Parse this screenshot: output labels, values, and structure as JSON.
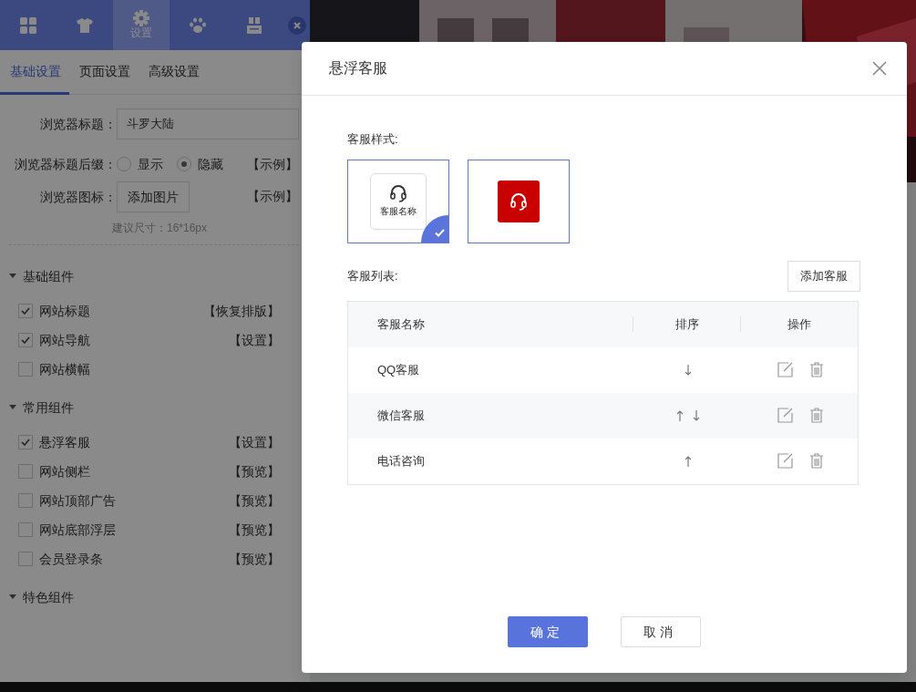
{
  "toolbar": {
    "tabs": [
      {
        "kind": "grid",
        "selected": false
      },
      {
        "kind": "shirt",
        "selected": false
      },
      {
        "kind": "gear",
        "label": "设置",
        "selected": true
      },
      {
        "kind": "paw",
        "selected": false
      },
      {
        "kind": "blocks",
        "selected": false
      }
    ]
  },
  "sub_tabs": [
    {
      "label": "基础设置",
      "selected": true
    },
    {
      "label": "页面设置",
      "selected": false
    },
    {
      "label": "高级设置",
      "selected": false
    }
  ],
  "form": {
    "title_field": {
      "label": "浏览器标题：",
      "value": "斗罗大陆"
    },
    "suffix": {
      "label": "浏览器标题后缀：",
      "options": [
        {
          "label": "显示",
          "selected": false
        },
        {
          "label": "隐藏",
          "selected": true
        }
      ],
      "link": "【示例】"
    },
    "favicon": {
      "label": "浏览器图标：",
      "button": "添加图片",
      "link": "【示例】",
      "hint": "建议尺寸：16*16px"
    }
  },
  "groups": [
    {
      "title": "基础组件",
      "expanded": true,
      "items": [
        {
          "label": "网站标题",
          "checked": true,
          "action": "【恢复排版】"
        },
        {
          "label": "网站导航",
          "checked": true,
          "action": "【设置】"
        },
        {
          "label": "网站横幅",
          "checked": false
        }
      ]
    },
    {
      "title": "常用组件",
      "expanded": true,
      "items": [
        {
          "label": "悬浮客服",
          "checked": true,
          "action": "【设置】"
        },
        {
          "label": "网站侧栏",
          "checked": false,
          "action": "【预览】"
        },
        {
          "label": "网站顶部广告",
          "checked": false,
          "action": "【预览】"
        },
        {
          "label": "网站底部浮层",
          "checked": false,
          "action": "【预览】"
        },
        {
          "label": "会员登录条",
          "checked": false,
          "action": "【预览】"
        }
      ]
    },
    {
      "title": "特色组件",
      "expanded": true
    }
  ],
  "dialog": {
    "title": "悬浮客服",
    "style_label": "客服样式:",
    "styles": [
      {
        "kind": "card",
        "label": "客服名称",
        "selected": true
      },
      {
        "kind": "red",
        "selected": false
      }
    ],
    "list_label": "客服列表:",
    "add_button": "添加客服",
    "columns": [
      "客服名称",
      "排序",
      "操作"
    ],
    "rows": [
      {
        "name": "QQ客服",
        "can_move_up": false,
        "can_move_down": true
      },
      {
        "name": "微信客服",
        "can_move_up": true,
        "can_move_down": true
      },
      {
        "name": "电话咨询",
        "can_move_up": true,
        "can_move_down": false
      }
    ],
    "confirm": "确定",
    "cancel": "取消"
  }
}
